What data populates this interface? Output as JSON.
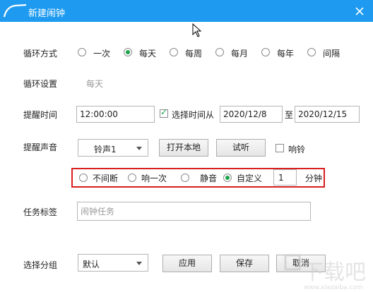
{
  "window": {
    "title": "新建闹钟"
  },
  "loop_mode": {
    "label": "循环方式",
    "options": [
      "一次",
      "每天",
      "每周",
      "每月",
      "每年",
      "间隔"
    ],
    "selected": "每天"
  },
  "loop_setting": {
    "label": "循环设置",
    "value": "每天"
  },
  "remind_time": {
    "label": "提醒时间",
    "time": "12:00:00",
    "range_checkbox_label": "选择时间从",
    "range_checked": true,
    "from": "2020/12/8",
    "to_label": "至",
    "to": "2020/12/15"
  },
  "remind_sound": {
    "label": "提醒声音",
    "sound": "铃声1",
    "open_local": "打开本地",
    "listen": "试听",
    "ring_label": "响铃",
    "ring_checked": false
  },
  "repeat_mode": {
    "options": [
      "不间断",
      "响一次",
      "静音",
      "自定义"
    ],
    "selected": "自定义",
    "custom_value": "1",
    "unit": "分钟"
  },
  "task_label": {
    "label": "任务标签",
    "placeholder": "闹钟任务"
  },
  "group": {
    "label": "选择分组",
    "value": "默认"
  },
  "buttons": {
    "apply": "应用",
    "save": "保存",
    "cancel": "取消"
  },
  "colors": {
    "titlebar": "#1e9bf0",
    "radio_checked": "#1aa34a",
    "highlight": "#d81e1e"
  },
  "watermark": {
    "text": "下载吧",
    "sub": "www.xiazaiba.com"
  }
}
